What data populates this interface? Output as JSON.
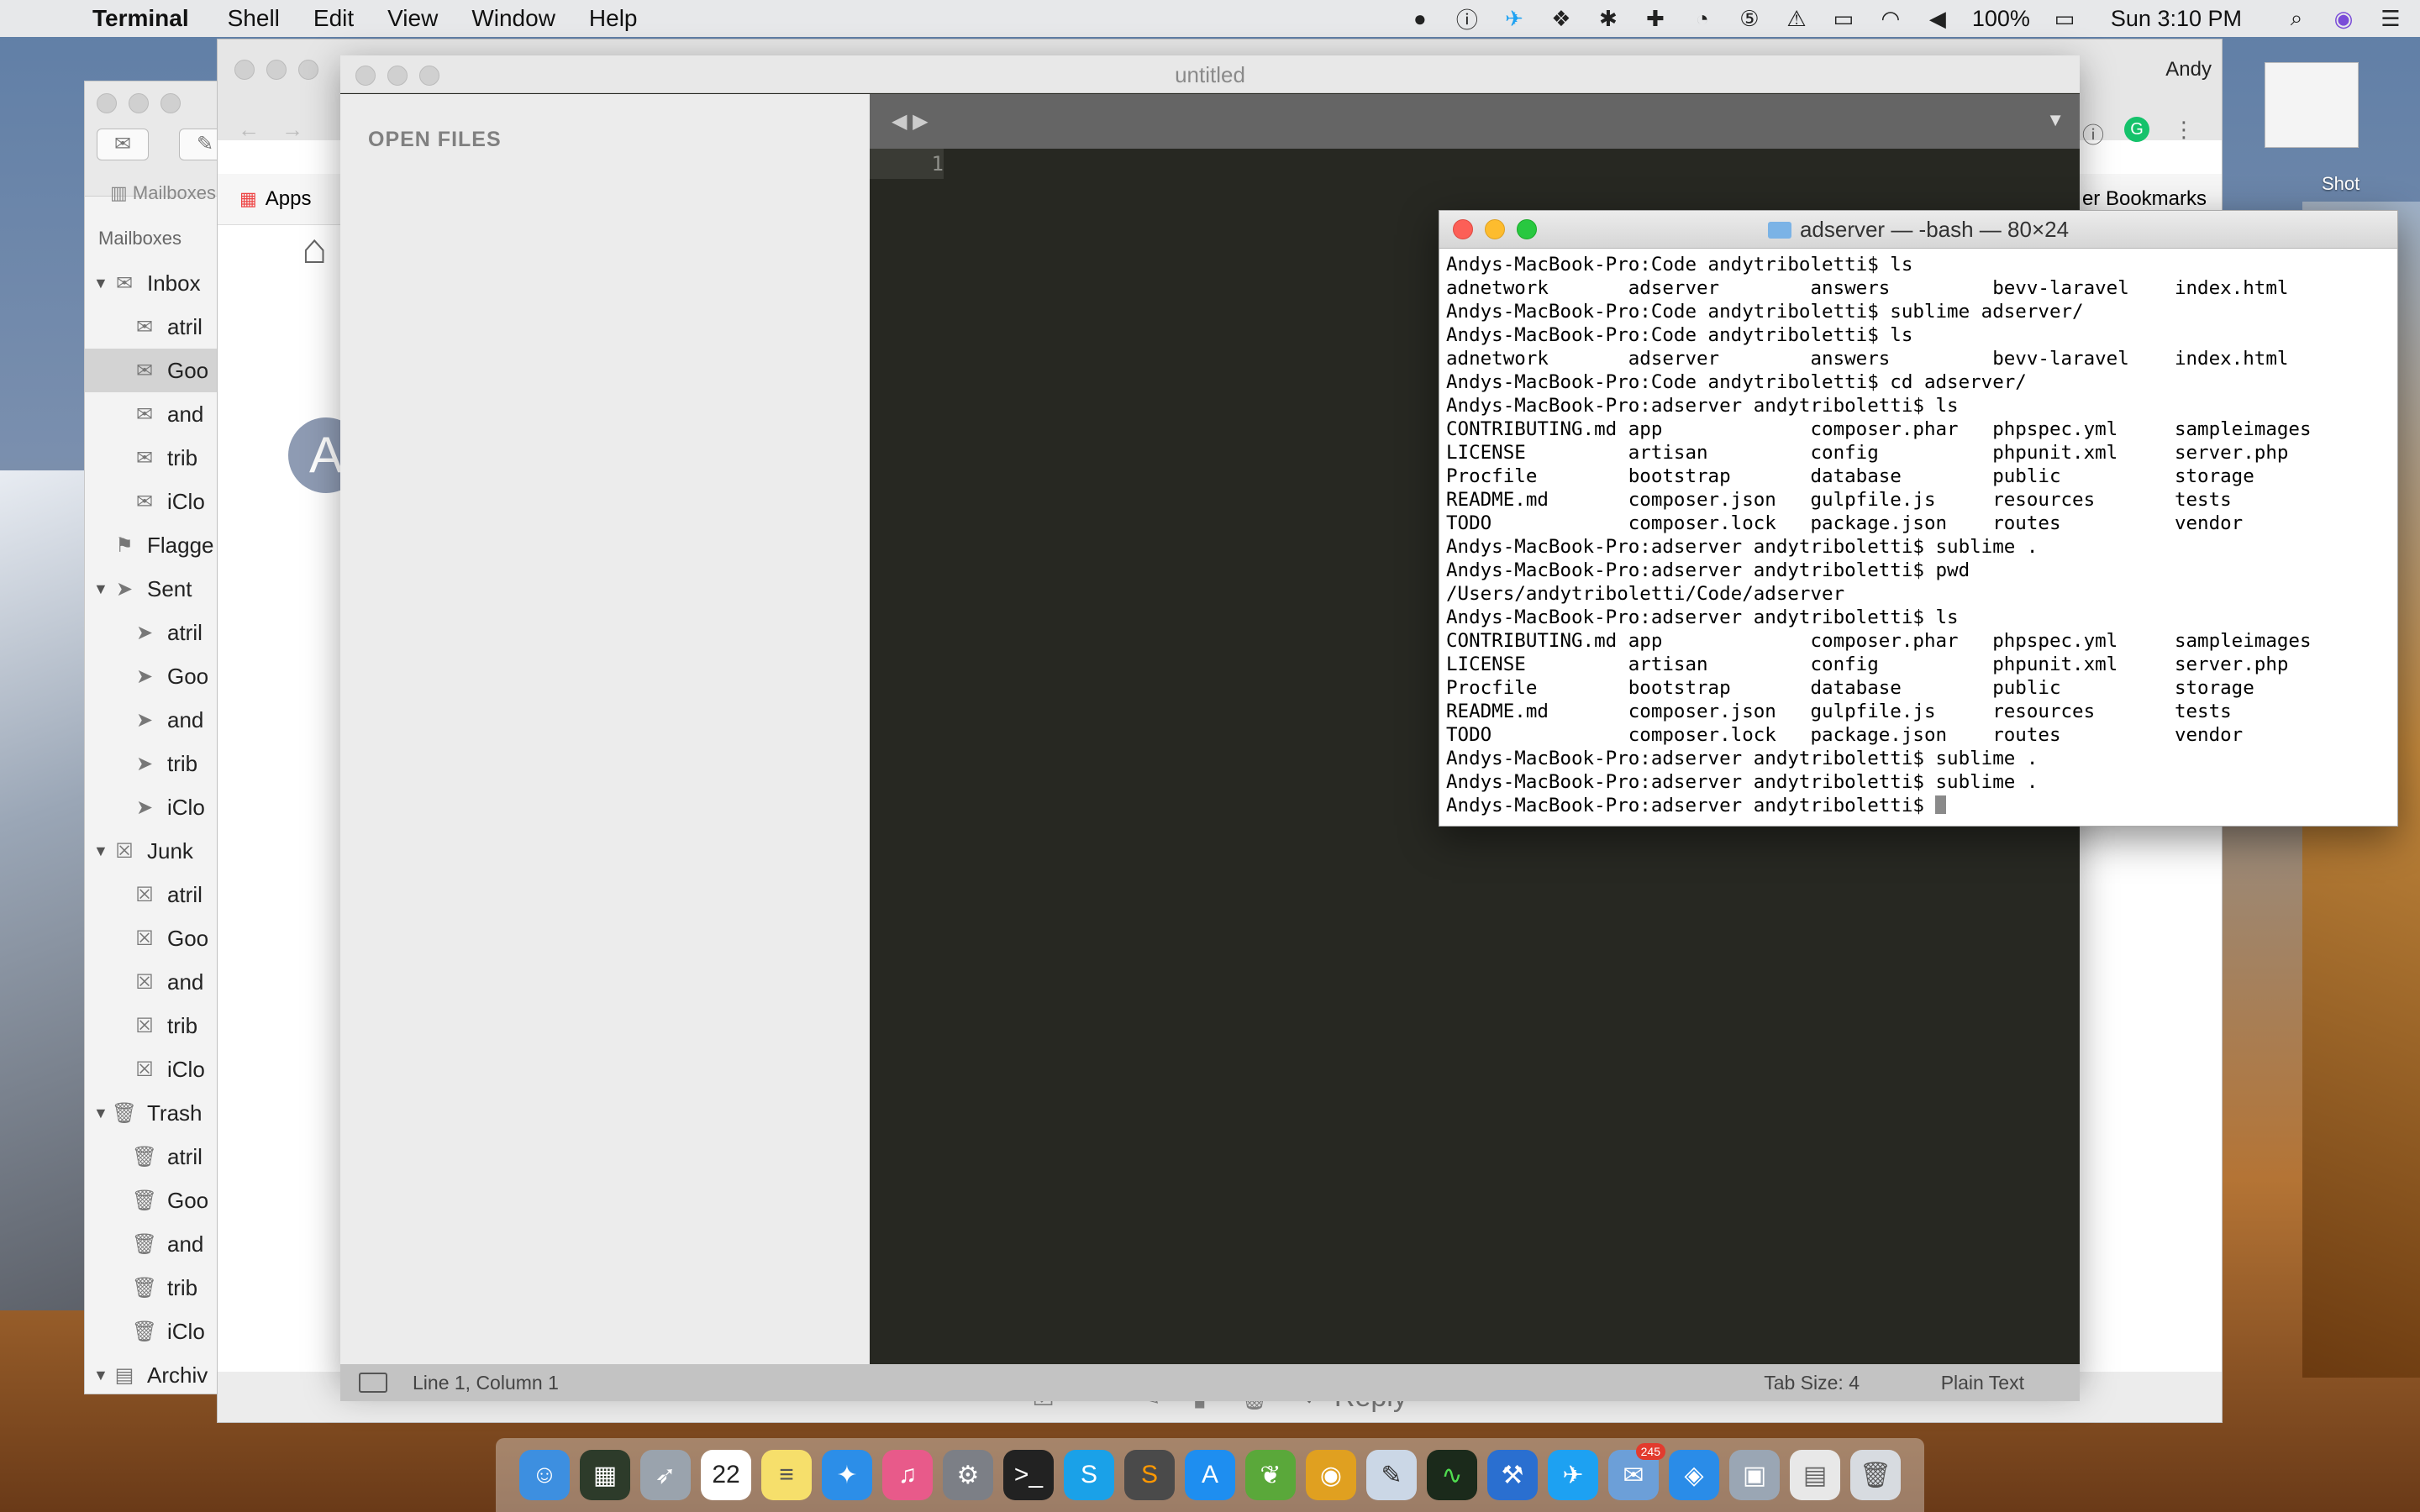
{
  "menubar": {
    "app": "Terminal",
    "items": [
      "Shell",
      "Edit",
      "View",
      "Window",
      "Help"
    ],
    "battery": "100%",
    "clock": "Sun 3:10 PM"
  },
  "desktop": {
    "label_shot": "Shot",
    "label_user": "Andy"
  },
  "mail": {
    "toolbar_label": "Mailboxes",
    "sidebar_head": "Mailboxes",
    "rows": [
      {
        "label": "Inbox",
        "indent": 0
      },
      {
        "label": "atril",
        "indent": 1
      },
      {
        "label": "Goo",
        "indent": 1,
        "selected": true
      },
      {
        "label": "and",
        "indent": 1
      },
      {
        "label": "trib",
        "indent": 1
      },
      {
        "label": "iClo",
        "indent": 1
      },
      {
        "label": "Flagge",
        "indent": 0
      },
      {
        "label": "Sent",
        "indent": 0
      },
      {
        "label": "atril",
        "indent": 1
      },
      {
        "label": "Goo",
        "indent": 1
      },
      {
        "label": "and",
        "indent": 1
      },
      {
        "label": "trib",
        "indent": 1
      },
      {
        "label": "iClo",
        "indent": 1
      },
      {
        "label": "Junk",
        "indent": 0
      },
      {
        "label": "atril",
        "indent": 1
      },
      {
        "label": "Goo",
        "indent": 1
      },
      {
        "label": "and",
        "indent": 1
      },
      {
        "label": "trib",
        "indent": 1
      },
      {
        "label": "iClo",
        "indent": 1
      },
      {
        "label": "Trash",
        "indent": 0
      },
      {
        "label": "atril",
        "indent": 1
      },
      {
        "label": "Goo",
        "indent": 1
      },
      {
        "label": "and",
        "indent": 1
      },
      {
        "label": "trib",
        "indent": 1
      },
      {
        "label": "iClo",
        "indent": 1
      },
      {
        "label": "Archiv",
        "indent": 0
      }
    ]
  },
  "chrome": {
    "apps_label": "Apps",
    "bookmarks_label": "er Bookmarks",
    "avatar_letter": "A",
    "reply_label": "Reply"
  },
  "sublime": {
    "title": "untitled",
    "sidebar_title": "OPEN FILES",
    "line_number": "1",
    "status_position": "Line 1, Column 1",
    "status_tab": "Tab Size: 4",
    "status_syntax": "Plain Text"
  },
  "terminal": {
    "title": "adserver — -bash — 80×24",
    "lines": [
      "Andys-MacBook-Pro:Code andytriboletti$ ls",
      "adnetwork       adserver        answers         bevv-laravel    index.html",
      "Andys-MacBook-Pro:Code andytriboletti$ sublime adserver/",
      "Andys-MacBook-Pro:Code andytriboletti$ ls",
      "adnetwork       adserver        answers         bevv-laravel    index.html",
      "Andys-MacBook-Pro:Code andytriboletti$ cd adserver/",
      "Andys-MacBook-Pro:adserver andytriboletti$ ls",
      "CONTRIBUTING.md app             composer.phar   phpspec.yml     sampleimages",
      "LICENSE         artisan         config          phpunit.xml     server.php",
      "Procfile        bootstrap       database        public          storage",
      "README.md       composer.json   gulpfile.js     resources       tests",
      "TODO            composer.lock   package.json    routes          vendor",
      "Andys-MacBook-Pro:adserver andytriboletti$ sublime .",
      "Andys-MacBook-Pro:adserver andytriboletti$ pwd",
      "/Users/andytriboletti/Code/adserver",
      "Andys-MacBook-Pro:adserver andytriboletti$ ls",
      "CONTRIBUTING.md app             composer.phar   phpspec.yml     sampleimages",
      "LICENSE         artisan         config          phpunit.xml     server.php",
      "Procfile        bootstrap       database        public          storage",
      "README.md       composer.json   gulpfile.js     resources       tests",
      "TODO            composer.lock   package.json    routes          vendor",
      "Andys-MacBook-Pro:adserver andytriboletti$ sublime .",
      "Andys-MacBook-Pro:adserver andytriboletti$ sublime .",
      "Andys-MacBook-Pro:adserver andytriboletti$ "
    ]
  },
  "dock": {
    "apps": [
      {
        "name": "finder-icon",
        "color": "#3d8fe0",
        "glyph": "☺"
      },
      {
        "name": "dashboard-icon",
        "color": "#2d3b2a",
        "glyph": "▦"
      },
      {
        "name": "launchpad-icon",
        "color": "#9aa3ad",
        "glyph": "➶"
      },
      {
        "name": "calendar-icon",
        "color": "#ffffff",
        "glyph": "22",
        "text_color": "#222"
      },
      {
        "name": "notes-icon",
        "color": "#f6df6b",
        "glyph": "≡",
        "text_color": "#555"
      },
      {
        "name": "safari-icon",
        "color": "#2c8ee8",
        "glyph": "✦"
      },
      {
        "name": "itunes-icon",
        "color": "#e85a8a",
        "glyph": "♫"
      },
      {
        "name": "system-preferences-icon",
        "color": "#7c7f86",
        "glyph": "⚙"
      },
      {
        "name": "terminal-icon",
        "color": "#222222",
        "glyph": ">_"
      },
      {
        "name": "skype-icon",
        "color": "#1aa1e8",
        "glyph": "S"
      },
      {
        "name": "sublime-icon",
        "color": "#4a4a4a",
        "glyph": "S",
        "text_color": "#ff9800"
      },
      {
        "name": "app-store-icon",
        "color": "#1e8ef0",
        "glyph": "A"
      },
      {
        "name": "leaf-icon",
        "color": "#5aa83a",
        "glyph": "❦"
      },
      {
        "name": "chrome-icon",
        "color": "#e0a020",
        "glyph": "◉"
      },
      {
        "name": "preview-icon",
        "color": "#cbd7e6",
        "glyph": "✎",
        "text_color": "#333"
      },
      {
        "name": "activity-monitor-icon",
        "color": "#1b2a1b",
        "glyph": "∿",
        "text_color": "#4fdc4f"
      },
      {
        "name": "xcode-icon",
        "color": "#2a6fd0",
        "glyph": "⚒"
      },
      {
        "name": "twitter-icon",
        "color": "#1da1f2",
        "glyph": "✈"
      },
      {
        "name": "mail-icon",
        "color": "#6c9fd8",
        "glyph": "✉",
        "badge": "245"
      },
      {
        "name": "maps-icon",
        "color": "#2a8ce8",
        "glyph": "◈"
      },
      {
        "name": "image-capture-icon",
        "color": "#9aa6b4",
        "glyph": "▣"
      },
      {
        "name": "archive-icon",
        "color": "#e8e8e8",
        "glyph": "▤",
        "text_color": "#666"
      },
      {
        "name": "trash-icon",
        "color": "#d7dbe0",
        "glyph": "🗑",
        "text_color": "#555"
      }
    ]
  }
}
